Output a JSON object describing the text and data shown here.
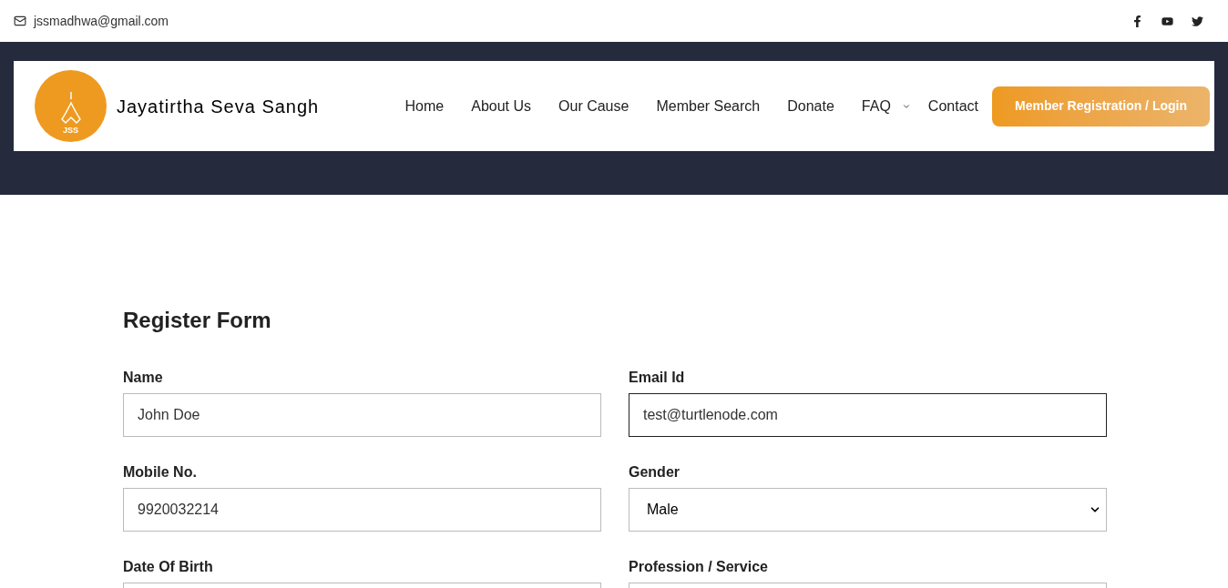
{
  "topbar": {
    "email": "jssmadhwa@gmail.com"
  },
  "header": {
    "logo_text": "JSS",
    "site_name": "Jayatirtha Seva Sangh",
    "nav": [
      {
        "label": "Home",
        "dropdown": false
      },
      {
        "label": "About Us",
        "dropdown": false
      },
      {
        "label": "Our Cause",
        "dropdown": false
      },
      {
        "label": "Member Search",
        "dropdown": false
      },
      {
        "label": "Donate",
        "dropdown": false
      },
      {
        "label": "FAQ",
        "dropdown": true
      },
      {
        "label": "Contact",
        "dropdown": false
      }
    ],
    "cta": "Member Registration / Login"
  },
  "form": {
    "title": "Register Form",
    "fields": [
      {
        "label": "Name",
        "kind": "text",
        "value": "John Doe",
        "focused": false
      },
      {
        "label": "Email Id",
        "kind": "text",
        "value": "test@turtlenode.com",
        "focused": true
      },
      {
        "label": "Mobile No.",
        "kind": "text",
        "value": "9920032214",
        "focused": false
      },
      {
        "label": "Gender",
        "kind": "select",
        "value": "Male",
        "focused": false
      },
      {
        "label": "Date Of Birth",
        "kind": "text",
        "focused": false
      },
      {
        "label": "Profession / Service",
        "kind": "text",
        "focused": false
      }
    ]
  }
}
